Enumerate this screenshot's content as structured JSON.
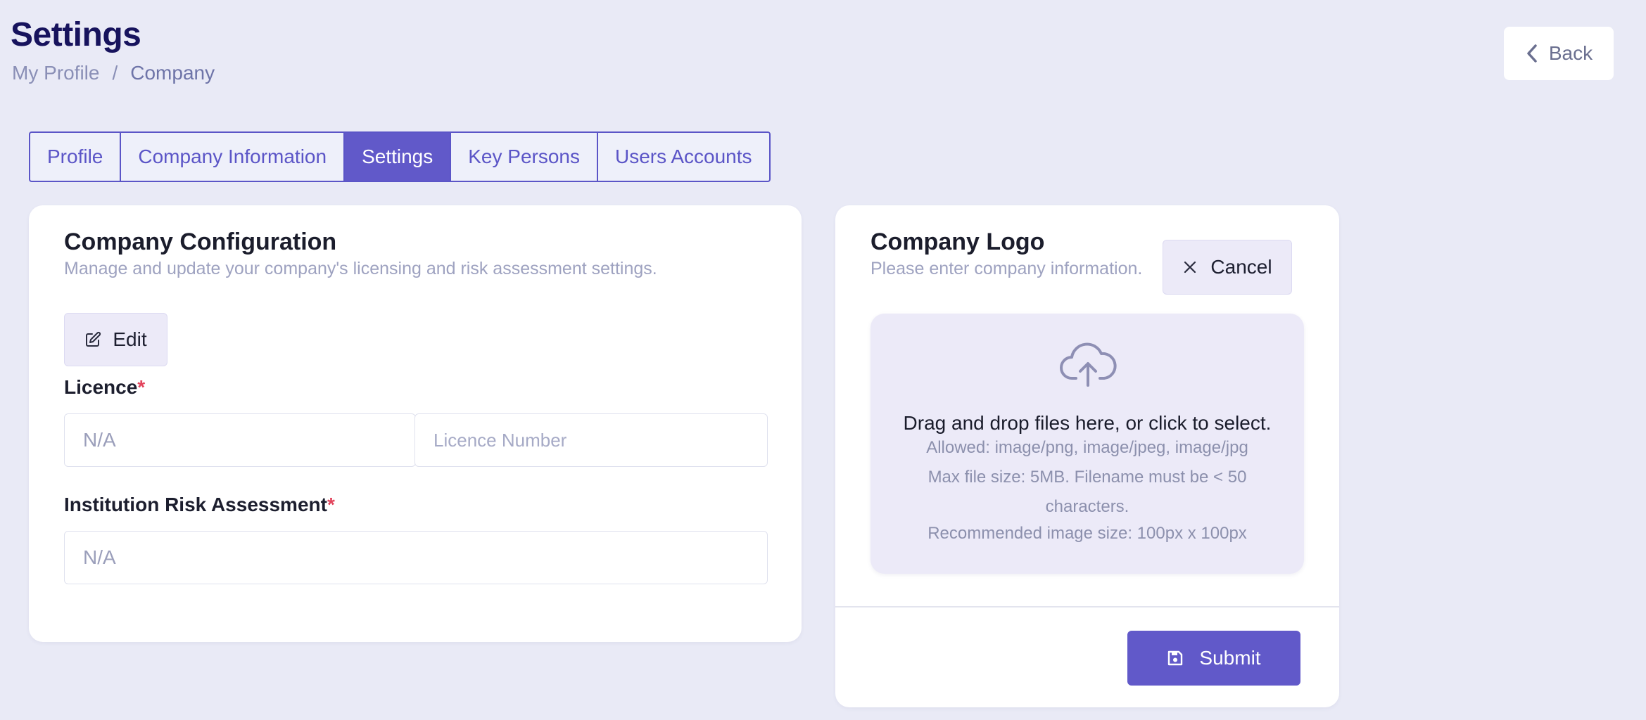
{
  "header": {
    "title": "Settings",
    "breadcrumb": {
      "parent": "My Profile",
      "separator": "/",
      "current": "Company"
    },
    "back_label": "Back"
  },
  "tabs": [
    {
      "label": "Profile",
      "active": false
    },
    {
      "label": "Company Information",
      "active": false
    },
    {
      "label": "Settings",
      "active": true
    },
    {
      "label": "Key Persons",
      "active": false
    },
    {
      "label": "Users Accounts",
      "active": false
    }
  ],
  "config": {
    "title": "Company Configuration",
    "subtitle": "Manage and update your company's licensing and risk assessment settings.",
    "edit_label": "Edit",
    "licence_label": "Licence",
    "required_mark": "*",
    "licence_value": "N/A",
    "licence_number_placeholder": "Licence Number",
    "risk_label": "Institution Risk Assessment",
    "risk_value": "N/A"
  },
  "logo": {
    "title": "Company Logo",
    "subtitle": "Please enter company information.",
    "cancel_label": "Cancel",
    "dropzone": {
      "main": "Drag and drop files here, or click to select.",
      "allowed": "Allowed: image/png, image/jpeg, image/jpg",
      "max_size": "Max file size: 5MB. Filename must be < 50 characters.",
      "recommended": "Recommended image size: 100px x 100px"
    },
    "submit_label": "Submit"
  },
  "icons": {
    "back": "chevron-left-icon",
    "edit": "edit-icon",
    "cancel": "close-icon",
    "upload": "cloud-upload-icon",
    "submit": "save-icon"
  },
  "colors": {
    "background": "#e9eaf6",
    "accent": "#6159c9",
    "title": "#17135d",
    "required": "#e2445c"
  }
}
